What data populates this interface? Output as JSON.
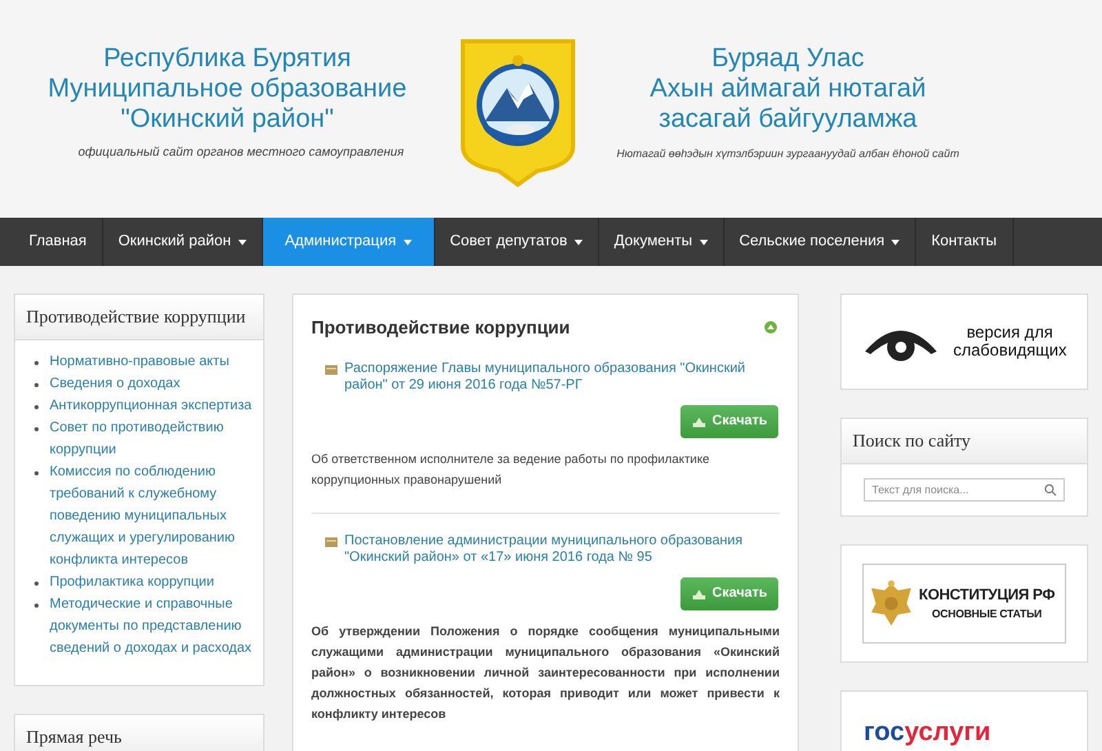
{
  "header": {
    "left_lines": [
      "Республика Бурятия",
      "Муниципальное образование",
      "\"Окинский район\""
    ],
    "left_subtitle": "официальный сайт органов местного самоуправления",
    "right_lines": [
      "Буряад Улас",
      "Ахын аймагай нютагай",
      "засагай байгууламжа"
    ],
    "right_subtitle": "Нютагай өөһэдын хүтэлбэриин зургаануудай албан ёһоной сайт"
  },
  "nav": [
    {
      "label": "Главная",
      "caret": false,
      "selected": false
    },
    {
      "label": "Окинский район",
      "caret": true,
      "selected": false
    },
    {
      "label": "Администрация",
      "caret": true,
      "selected": true
    },
    {
      "label": "Совет депутатов",
      "caret": true,
      "selected": false
    },
    {
      "label": "Документы",
      "caret": true,
      "selected": false
    },
    {
      "label": "Сельские поселения",
      "caret": true,
      "selected": false
    },
    {
      "label": "Контакты",
      "caret": false,
      "selected": false
    }
  ],
  "left_panels": [
    {
      "title": "Противодействие коррупции",
      "items": [
        "Нормативно-правовые акты",
        "Сведения о доходах",
        "Антикоррупционная экспертиза",
        "Совет по противодействию коррупции",
        "Комиссия по соблюдению требований к служебному поведению муниципальных служащих и урегулированию конфликта интересов",
        "Профилактика коррупции",
        "Методические и справочные документы по представлению сведений о доходах и расходах"
      ]
    },
    {
      "title": "Прямая речь"
    }
  ],
  "main": {
    "title": "Противодействие коррупции",
    "documents": [
      {
        "link": "Распоряжение Главы муниципального образования \"Окинский район\" от 29 июня 2016 года №57-РГ",
        "button": "Скачать",
        "description": "Об ответственном исполнителе за ведение работы по профилактике коррупционных правонарушений",
        "bold": false
      },
      {
        "link": "Постановление администрации муниципального образования \"Окинский район» от «17» июня 2016 года № 95",
        "button": "Скачать",
        "description": "Об утверждении Положения о порядке сообщения муниципальными служащими администрации муниципального образования «Окинский район» о возникновении личной заинтересованности при исполнении должностных обязанностей, которая приводит или может привести к конфликту интересов",
        "bold": true
      }
    ]
  },
  "right": {
    "accessibility": "версия для слабовидящих",
    "search_title": "Поиск по сайту",
    "search_placeholder": "Текст для поиска...",
    "constitution": [
      "КОНСТИТУЦИЯ РФ",
      "ОСНОВНЫЕ СТАТЬИ"
    ],
    "gosuslugi": [
      "гос",
      "услуги"
    ]
  }
}
